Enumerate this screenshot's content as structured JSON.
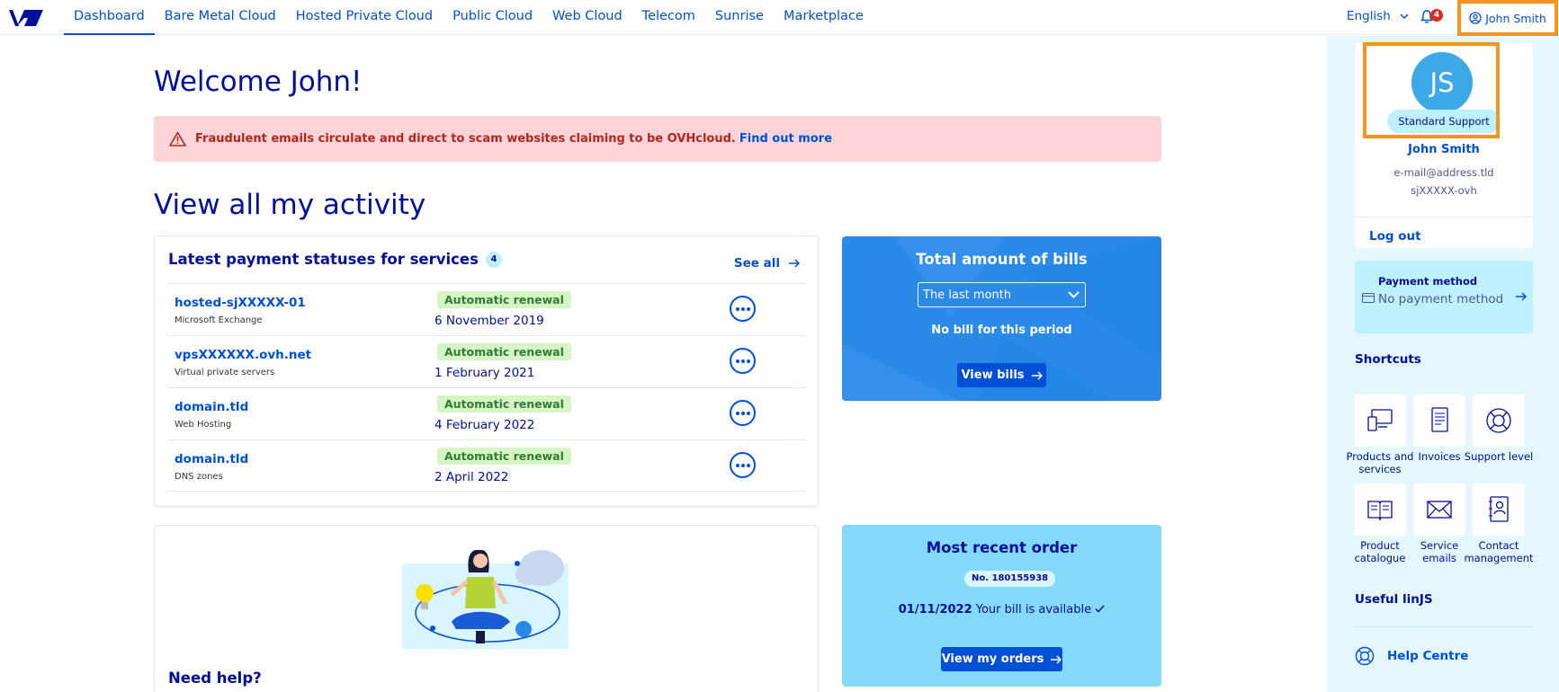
{
  "nav": {
    "items": [
      "Dashboard",
      "Bare Metal Cloud",
      "Hosted Private Cloud",
      "Public Cloud",
      "Web Cloud",
      "Telecom",
      "Sunrise",
      "Marketplace"
    ],
    "language": "English",
    "notification_count": "4",
    "user_label": "John Smith"
  },
  "main": {
    "welcome": "Welcome John!",
    "alert_text": "Fraudulent emails circulate and direct to scam websites claiming to be OVHcloud.",
    "alert_link": "Find out more",
    "activity_title": "View all my activity"
  },
  "payments": {
    "title": "Latest payment statuses for services",
    "count": "4",
    "see_all": "See all",
    "rows": [
      {
        "name": "hosted-sjXXXXX-01",
        "type": "Microsoft Exchange",
        "status": "Automatic renewal",
        "date": "6 November 2019"
      },
      {
        "name": "vpsXXXXXX.ovh.net",
        "type": "Virtual private servers",
        "status": "Automatic renewal",
        "date": "1 February 2021"
      },
      {
        "name": "domain.tld",
        "type": "Web Hosting",
        "status": "Automatic renewal",
        "date": "4 February 2022"
      },
      {
        "name": "domain.tld",
        "type": "DNS zones",
        "status": "Automatic renewal",
        "date": "2 April 2022"
      }
    ]
  },
  "bills": {
    "title": "Total amount of bills",
    "period": "The last month",
    "empty": "No bill for this period",
    "button": "View bills"
  },
  "help": {
    "title": "Need help?"
  },
  "order": {
    "title": "Most recent order",
    "number": "No. 180155938",
    "date": "01/11/2022",
    "status": "Your bill is available",
    "button": "View my orders"
  },
  "profile": {
    "initials": "JS",
    "support": "Standard Support",
    "name": "John Smith",
    "email": "e-mail@address.tld",
    "id": "sjXXXXX-ovh",
    "logout": "Log out"
  },
  "payment_method": {
    "label": "Payment method",
    "value": "No payment method"
  },
  "shortcuts": {
    "title": "Shortcuts",
    "items": [
      {
        "label": "Products and services",
        "icon": "products-icon"
      },
      {
        "label": "Invoices",
        "icon": "invoices-icon"
      },
      {
        "label": "Support level",
        "icon": "lifebuoy-icon"
      },
      {
        "label": "Product catalogue",
        "icon": "catalogue-icon"
      },
      {
        "label": "Service emails",
        "icon": "envelope-icon"
      },
      {
        "label": "Contact management",
        "icon": "contact-icon"
      }
    ]
  },
  "useful": {
    "title": "Useful linJS",
    "help_centre": "Help Centre"
  },
  "colors": {
    "primary": "#0050d7",
    "dark_text": "#000e9c",
    "alert_bg": "#ffd4d8",
    "sidebar_bg": "#e4f7ff",
    "highlight": "#f7931e"
  }
}
